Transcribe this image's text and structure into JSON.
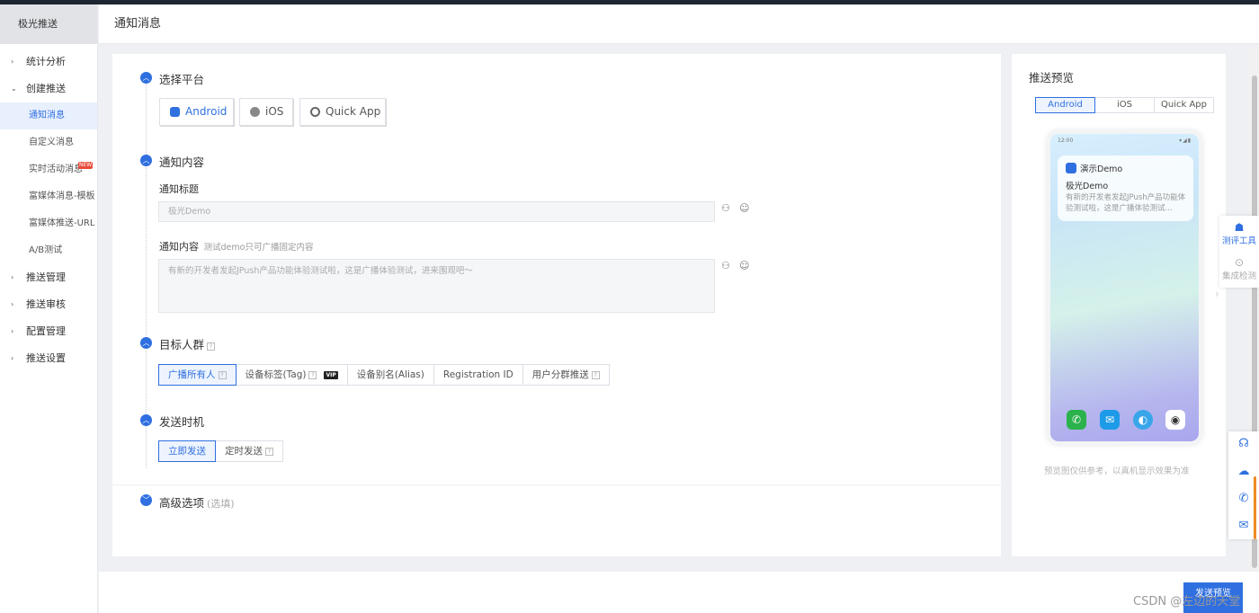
{
  "sidebar": {
    "brand": "极光推送",
    "items": [
      {
        "label": "统计分析",
        "arrow": "›"
      },
      {
        "label": "创建推送",
        "arrow": "⌄"
      }
    ],
    "sub_items": [
      {
        "label": "通知消息"
      },
      {
        "label": "自定义消息"
      },
      {
        "label": "实时活动消息",
        "badge": "NEW"
      },
      {
        "label": "富媒体消息-模板"
      },
      {
        "label": "富媒体推送-URL"
      },
      {
        "label": "A/B测试"
      }
    ],
    "items_after": [
      {
        "label": "推送管理",
        "arrow": "›"
      },
      {
        "label": "推送审核",
        "arrow": "›"
      },
      {
        "label": "配置管理",
        "arrow": "›"
      },
      {
        "label": "推送设置",
        "arrow": "›"
      }
    ]
  },
  "header": {
    "title": "通知消息"
  },
  "platform": {
    "title": "选择平台",
    "buttons": [
      "Android",
      "iOS",
      "Quick App"
    ]
  },
  "content": {
    "title": "通知内容",
    "title_label": "通知标题",
    "title_placeholder": "极光Demo",
    "content_label": "通知内容",
    "content_hint": "测试demo只可广播固定内容",
    "content_placeholder": "有新的开发者发起JPush产品功能体验测试啦，这是广播体验测试，进来围观吧～"
  },
  "target": {
    "title": "目标人群",
    "options": [
      "广播所有人",
      "设备标签(Tag)",
      "设备别名(Alias)",
      "Registration ID",
      "用户分群推送"
    ],
    "vip": "VIP"
  },
  "timing": {
    "title": "发送时机",
    "options": [
      "立即发送",
      "定时发送"
    ]
  },
  "advanced": {
    "title": "高级选项",
    "optional": "(选填)"
  },
  "preview": {
    "title": "推送预览",
    "tabs": [
      "Android",
      "iOS",
      "Quick App"
    ],
    "time": "12:00",
    "app_name": "演示Demo",
    "notif_title": "极光Demo",
    "notif_body": "有新的开发者发起JPush产品功能体验测试啦，这是广播体验测试…",
    "note": "预览图仅供参考，以真机显示效果为准"
  },
  "tools": {
    "eval": "测评工具",
    "integration": "集成检测"
  },
  "footer": {
    "send": "发送预览",
    "watermark": "CSDN @左边的天堂"
  },
  "colors": {
    "accent": "#2f6fe0",
    "badge": "#e84a3a"
  }
}
